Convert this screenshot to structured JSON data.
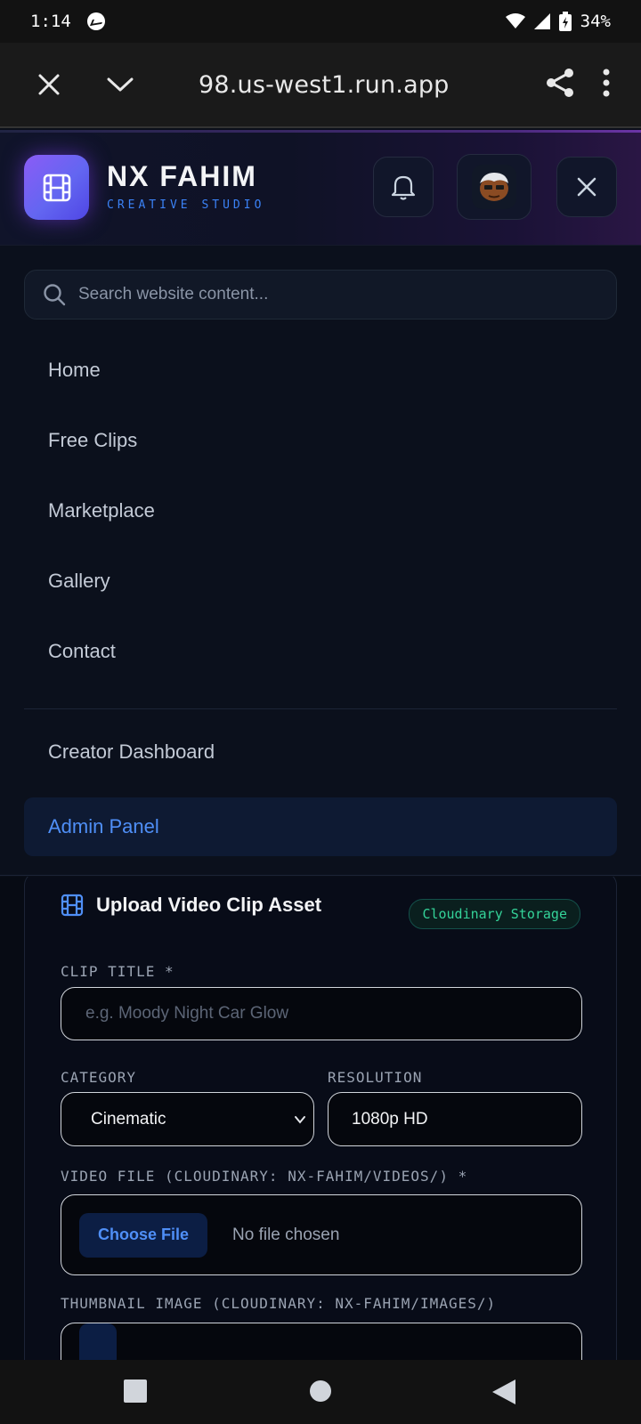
{
  "status_bar": {
    "time": "1:14",
    "battery": "34%"
  },
  "browser": {
    "url": "98.us-west1.run.app"
  },
  "header": {
    "brand_name": "NX FAHIM",
    "brand_subtitle": "CREATIVE STUDIO"
  },
  "search": {
    "placeholder": "Search website content..."
  },
  "nav": {
    "primary": [
      {
        "label": "Home"
      },
      {
        "label": "Free Clips"
      },
      {
        "label": "Marketplace"
      },
      {
        "label": "Gallery"
      },
      {
        "label": "Contact"
      }
    ],
    "secondary": [
      {
        "label": "Creator Dashboard"
      },
      {
        "label": "Admin Panel",
        "active": true
      }
    ]
  },
  "upload": {
    "title": "Upload Video Clip Asset",
    "badge": "Cloudinary Storage",
    "clip_title_label": "CLIP TITLE *",
    "clip_title_placeholder": "e.g. Moody Night Car Glow",
    "category_label": "CATEGORY",
    "category_value": "Cinematic",
    "resolution_label": "RESOLUTION",
    "resolution_value": "1080p HD",
    "video_label": "VIDEO FILE (CLOUDINARY: NX-FAHIM/VIDEOS/) *",
    "choose_file": "Choose File",
    "no_file": "No file chosen",
    "thumbnail_label": "THUMBNAIL IMAGE (CLOUDINARY: NX-FAHIM/IMAGES/)"
  },
  "colors": {
    "accent": "#4f8ff7",
    "logo_gradient": "#8b5cf6",
    "badge_green": "#34d399"
  },
  "icons": [
    "messenger-icon",
    "wifi-icon",
    "signal-icon",
    "battery-icon",
    "close-icon",
    "chevron-down-icon",
    "share-icon",
    "more-vert-icon",
    "film-icon",
    "bell-icon",
    "avatar",
    "search-icon"
  ]
}
